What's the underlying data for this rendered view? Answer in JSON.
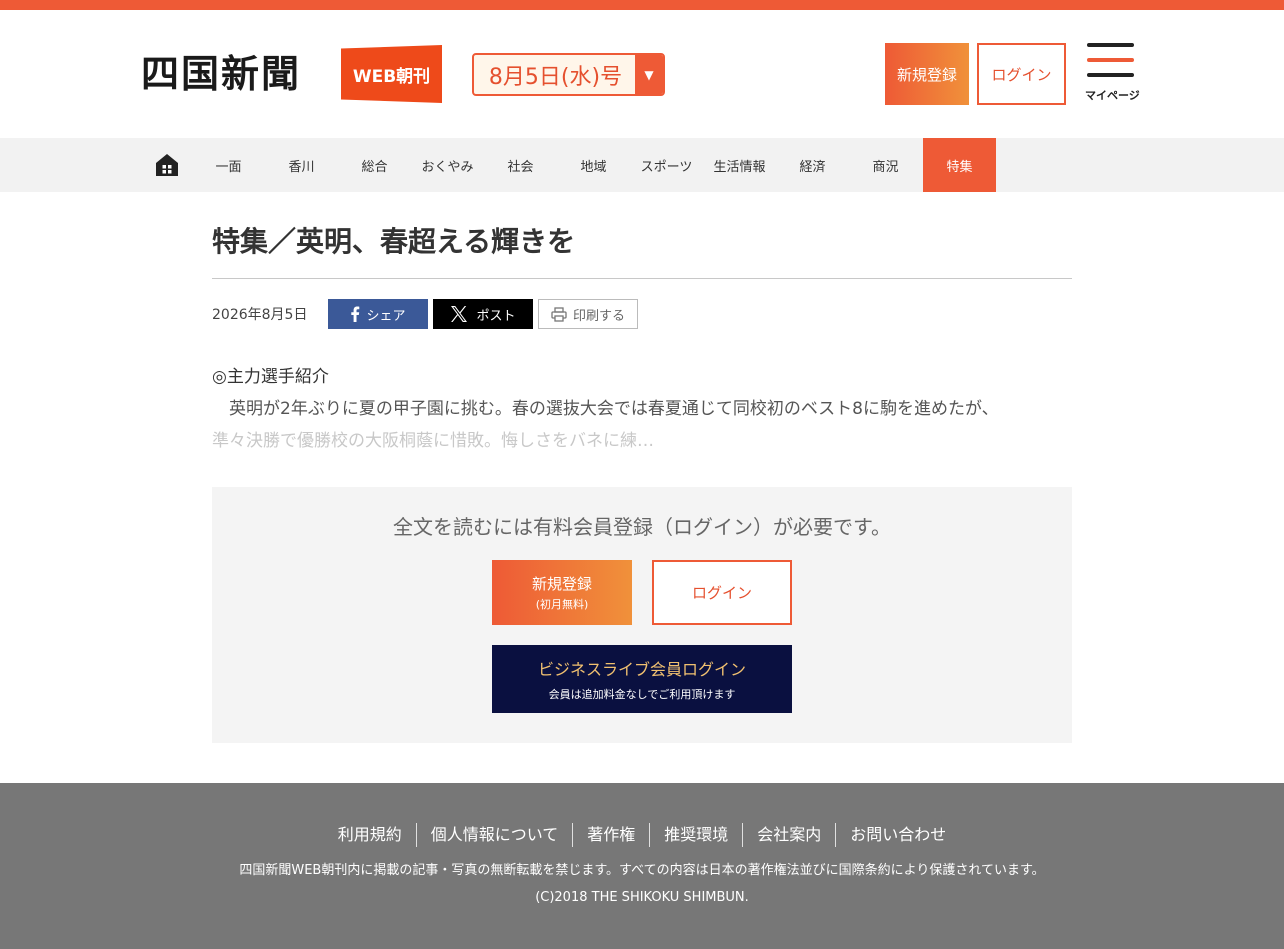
{
  "header": {
    "logo": "四国新聞",
    "web_badge": "WEB朝刊",
    "edition": "8月5日(水)号",
    "register_label": "新規登録",
    "login_label": "ログイン",
    "mypage_label": "マイページ"
  },
  "nav": {
    "home_icon": "home-icon",
    "items": [
      {
        "label": "一面"
      },
      {
        "label": "香川"
      },
      {
        "label": "総合"
      },
      {
        "label": "おくやみ"
      },
      {
        "label": "社会"
      },
      {
        "label": "地域"
      },
      {
        "label": "スポーツ"
      },
      {
        "label": "生活情報"
      },
      {
        "label": "経済"
      },
      {
        "label": "商況"
      },
      {
        "label": "特集"
      }
    ],
    "active": "特集"
  },
  "article": {
    "title": "特集／英明、春超える輝きを",
    "date": "2026年8月5日",
    "share_fb": "シェア",
    "share_x": "ポスト",
    "print": "印刷する",
    "section_head": "◎主力選手紹介",
    "body_line1": "　英明が2年ぶりに夏の甲子園に挑む。春の選抜大会では春夏通じて同校初のベスト8に駒を進めたが、",
    "body_line2": "準々決勝で優勝校の大阪桐蔭に惜敗。悔しさをバネに練…"
  },
  "paywall": {
    "message": "全文を読むには有料会員登録（ログイン）が必要です。",
    "register_main": "新規登録",
    "register_sub": "(初月無料)",
    "login": "ログイン",
    "biz_main": "ビジネスライブ会員ログイン",
    "biz_sub": "会員は追加料金なしでご利用頂けます"
  },
  "footer": {
    "links": [
      {
        "label": "利用規約"
      },
      {
        "label": "個人情報について"
      },
      {
        "label": "著作権"
      },
      {
        "label": "推奨環境"
      },
      {
        "label": "会社案内"
      },
      {
        "label": "お問い合わせ"
      }
    ],
    "note": "四国新聞WEB朝刊内に掲載の記事・写真の無断転載を禁じます。すべての内容は日本の著作権法並びに国際条約により保護されています。",
    "copyright": "(C)2018 THE SHIKOKU SHIMBUN."
  },
  "colors": {
    "accent": "#ee5a36",
    "nav_bg": "#f2f2f2",
    "footer_bg": "#777777",
    "biz_bg": "#0a1040",
    "facebook": "#3b5998"
  }
}
